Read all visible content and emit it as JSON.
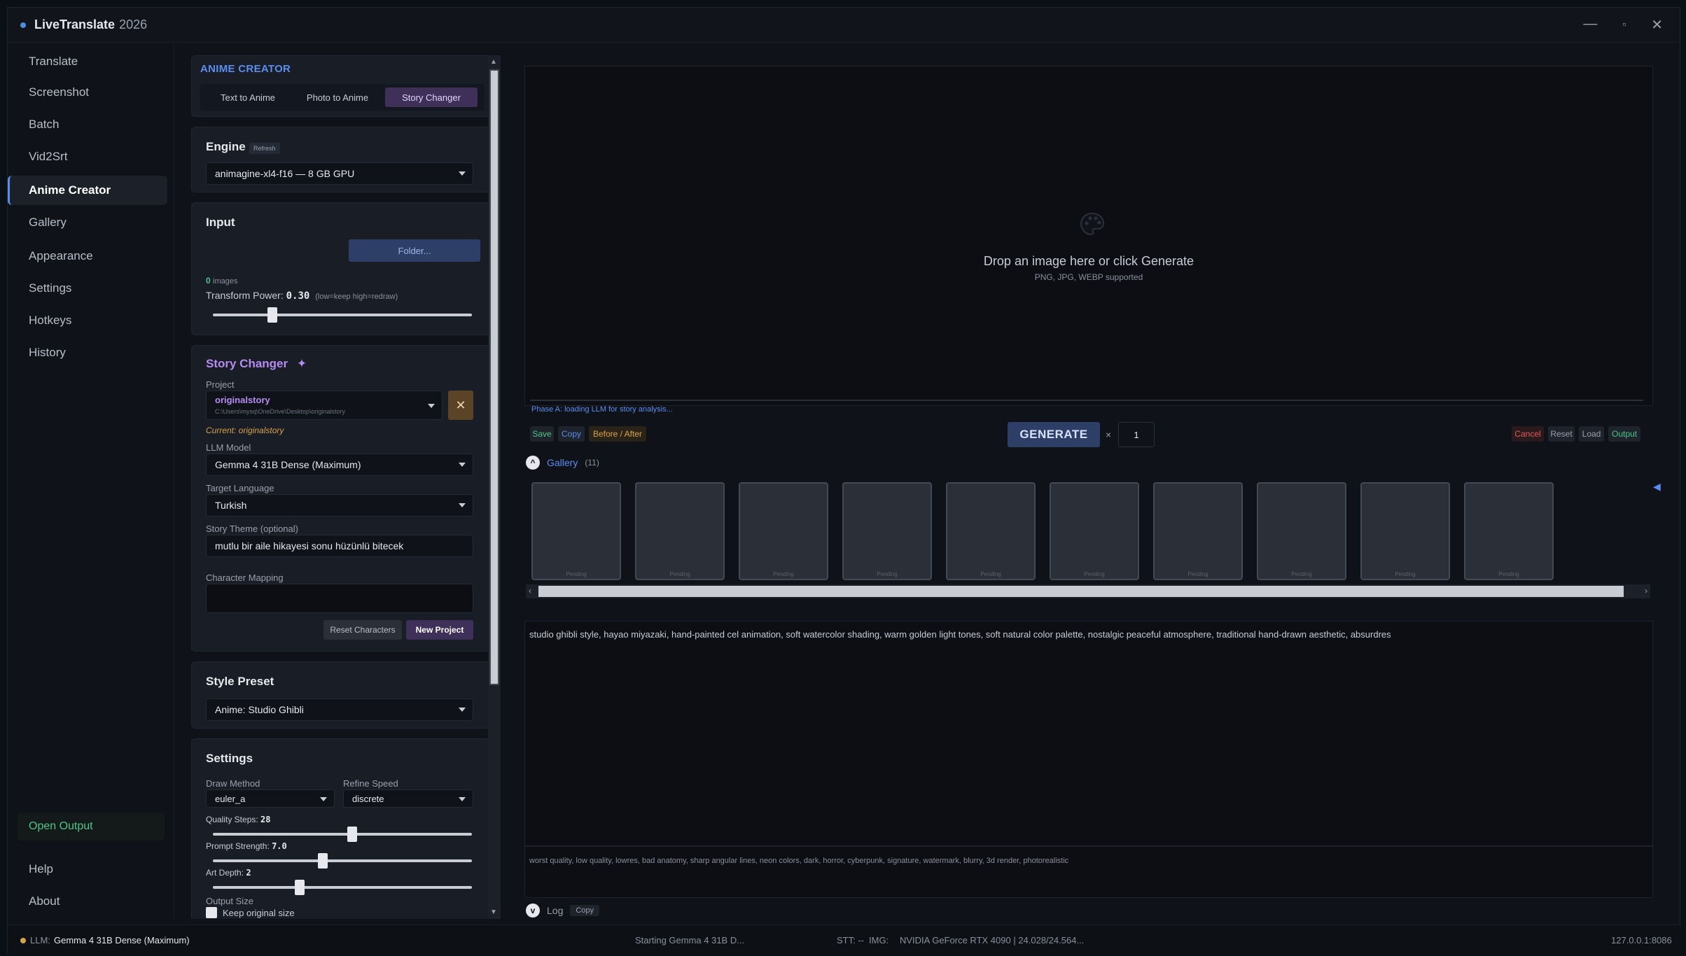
{
  "window": {
    "app_name": "LiveTranslate",
    "year": "2026",
    "minimize": "—",
    "maximize": "▫",
    "close": "✕"
  },
  "sidebar": {
    "items": [
      {
        "label": "Translate"
      },
      {
        "label": "Screenshot"
      },
      {
        "label": "Batch"
      },
      {
        "label": "Vid2Srt"
      },
      {
        "label": "Anime Creator"
      },
      {
        "label": "Gallery"
      },
      {
        "label": "Appearance"
      },
      {
        "label": "Settings"
      },
      {
        "label": "Hotkeys"
      },
      {
        "label": "History"
      }
    ],
    "open_output": "Open Output",
    "help": "Help",
    "about": "About"
  },
  "anime_creator": {
    "title": "ANIME CREATOR",
    "tabs": [
      "Text to Anime",
      "Photo to Anime",
      "Story Changer"
    ],
    "active_tab": "Story Changer"
  },
  "engine": {
    "title": "Engine",
    "refresh": "Refresh",
    "value": "animagine-xl4-f16 — 8 GB GPU"
  },
  "input": {
    "title": "Input",
    "folder_button": "Folder...",
    "image_count": "0",
    "images_label": "images",
    "transform_label": "Transform Power:",
    "transform_value": "0.30",
    "transform_hint": "(low=keep  high=redraw)",
    "transform_level": 0.22
  },
  "story": {
    "title": "Story Changer",
    "sparkle": "✦",
    "project_label": "Project",
    "project_name": "originalstory",
    "project_path": "C:\\Users\\mysq\\OneDrive\\Desktop\\originalstory",
    "current": "Current: originalstory",
    "llm_label": "LLM Model",
    "llm_value": "Gemma 4 31B Dense (Maximum)",
    "lang_label": "Target Language",
    "lang_value": "Turkish",
    "theme_label": "Story Theme (optional)",
    "theme_value": "mutlu bir aile hikayesi sonu hüzünlü bitecek",
    "mapping_label": "Character Mapping",
    "mapping_value": "",
    "reset_button": "Reset Characters",
    "new_button": "New Project"
  },
  "style": {
    "title": "Style Preset",
    "value": "Anime: Studio Ghibli"
  },
  "settings": {
    "title": "Settings",
    "draw_label": "Draw Method",
    "draw_value": "euler_a",
    "refine_label": "Refine Speed",
    "refine_value": "discrete",
    "quality_label": "Quality Steps:",
    "quality_value": "28",
    "quality_level": 0.54,
    "prompt_label": "Prompt Strength:",
    "prompt_value": "7.0",
    "prompt_level": 0.42,
    "depth_label": "Art Depth:",
    "depth_value": "2",
    "depth_level": 0.33,
    "output_label": "Output Size",
    "keep_label": "Keep original size"
  },
  "preview": {
    "icon": "palette-icon",
    "main": "Drop an image here or click Generate",
    "sub": "PNG, JPG, WEBP supported",
    "phase": "Phase A: loading LLM for story analysis..."
  },
  "toolbar": {
    "save": "Save",
    "copy": "Copy",
    "before_after": "Before / After",
    "generate": "GENERATE",
    "x": "×",
    "count": "1",
    "cancel": "Cancel",
    "reset": "Reset",
    "load": "Load",
    "output": "Output"
  },
  "gallery": {
    "label": "Gallery",
    "count": "(11)",
    "pending": "Pending"
  },
  "prompt": {
    "positive": "studio ghibli style, hayao miyazaki, hand-painted cel animation, soft watercolor shading, warm golden light tones, soft natural color palette, nostalgic peaceful atmosphere, traditional hand-drawn aesthetic, absurdres",
    "negative": "worst quality, low quality, lowres, bad anatomy, sharp angular lines, neon colors, dark, horror, cyberpunk, signature, watermark, blurry, 3d render, photorealistic"
  },
  "log": {
    "label": "Log",
    "copy": "Copy"
  },
  "status": {
    "llm_prefix": "LLM:",
    "llm": "Gemma 4 31B Dense (Maximum)",
    "starting": "Starting Gemma 4 31B D...",
    "stt": "STT: --",
    "img": "IMG:",
    "gpu": "NVIDIA GeForce RTX 4090 | 24.028/24.564...",
    "address": "127.0.0.1:8086"
  },
  "colors": {
    "accent": "#5b8def",
    "story": "#b48cf2",
    "green": "#4fc48b",
    "cancel": "#e05a5a",
    "before_after": "#d8a24a"
  }
}
